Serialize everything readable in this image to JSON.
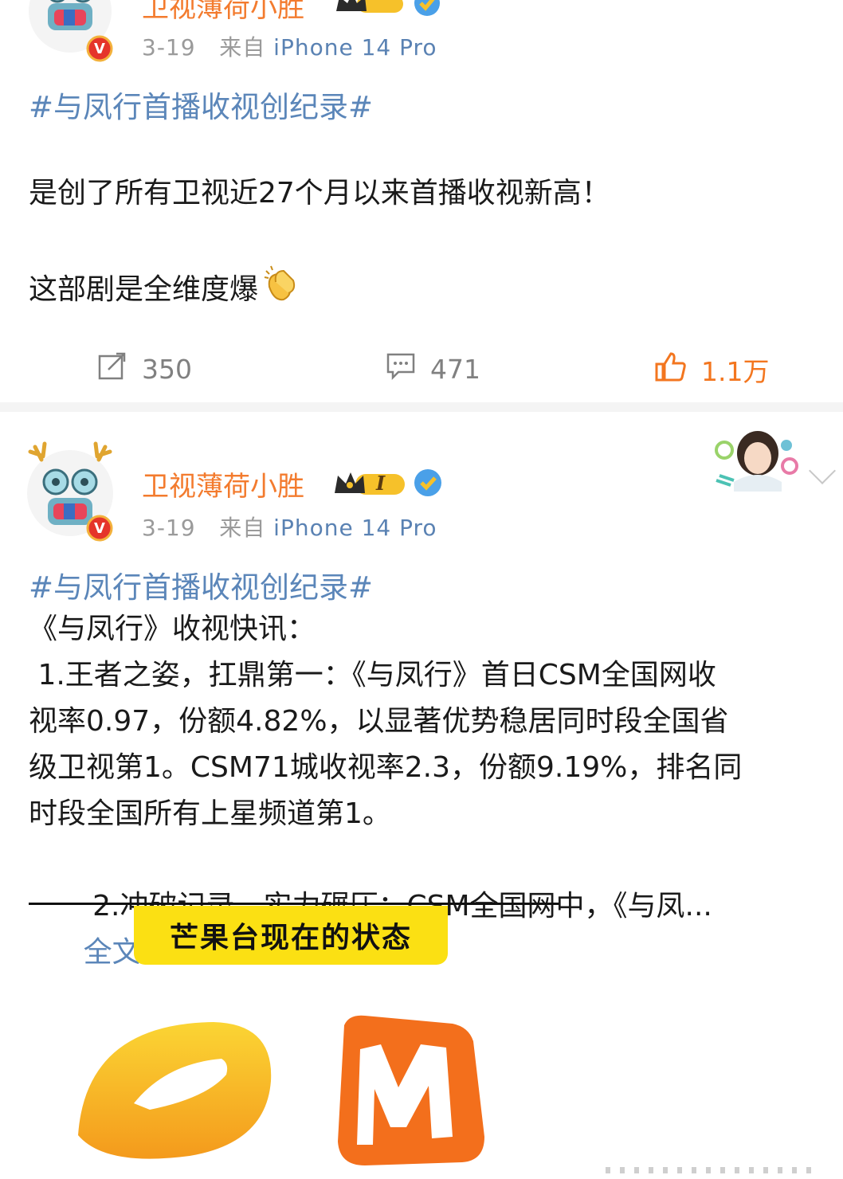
{
  "post1": {
    "author": "卫视薄荷小胜",
    "date": "3-19",
    "source_prefix": "来自",
    "source_device": "iPhone 14 Pro",
    "hashtag": "#与凤行首播收视创纪录#",
    "line1": "是创了所有卫视近27个月以来首播收视新高！",
    "line2": "这部剧是全维度爆",
    "emoji_icon": "clapping-hands",
    "repost_count": "350",
    "comment_count": "471",
    "like_count": "1.1万"
  },
  "post2": {
    "author": "卫视薄荷小胜",
    "vip_level": "I",
    "date": "3-19",
    "source_prefix": "来自",
    "source_device": "iPhone 14 Pro",
    "hashtag": "#与凤行首播收视创纪录#",
    "lines": [
      "《与凤行》收视快讯：",
      " 1.王者之姿，扛鼎第一：《与凤行》首日CSM全国网收",
      "视率0.97，份额4.82%，以显著优势稳居同时段全国省",
      "级卫视第1。CSM71城收视率2.3，份额9.19%，排名同",
      "时段全国所有上星频道第1。",
      " 2.冲破记录，实力碾压：CSM全国网中，《与凤..."
    ],
    "more_label": "全文",
    "image_banner_text": "芒果台现在的状态"
  },
  "colors": {
    "accent_orange": "#f37b2e",
    "link_blue": "#5b86b9",
    "meta_gray": "#9a9a9a",
    "banner_yellow": "#fbe013"
  }
}
